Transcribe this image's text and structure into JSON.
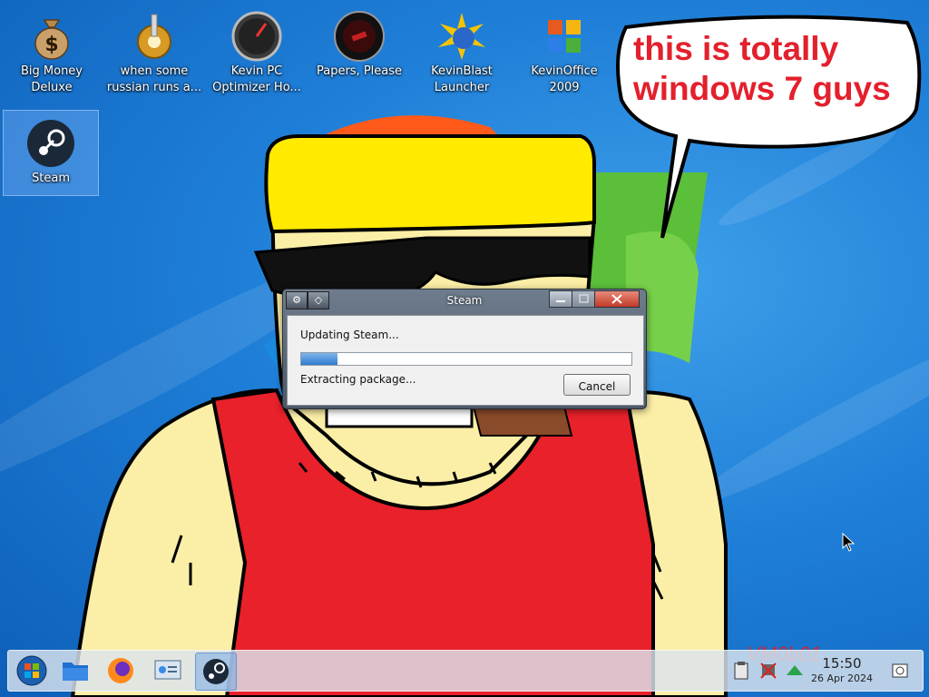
{
  "desktop": {
    "icons": [
      {
        "label": "Big Money Deluxe"
      },
      {
        "label": "when some russian runs a..."
      },
      {
        "label": "Kevin PC Optimizer Ho..."
      },
      {
        "label": "Papers, Please"
      },
      {
        "label": "KevinBlast Launcher"
      },
      {
        "label": "KevinOffice 2009"
      },
      {
        "label": "Steam"
      }
    ],
    "bubble_text": "this is totally windows 7 guys"
  },
  "window": {
    "title": "Steam",
    "status_top": "Updating Steam...",
    "progress_fraction": 0.11,
    "status_bottom": "Extracting package...",
    "cancel_label": "Cancel"
  },
  "taskbar": {
    "apps": [
      "start-orb-icon",
      "file-manager-icon",
      "firefox-icon",
      "system-settings-icon",
      "steam-icon"
    ],
    "time": "15:50",
    "date": "26 Apr 2024"
  },
  "colors": {
    "bubble_text": "#e3202c",
    "desktop_bg": "#1f7fd8"
  }
}
